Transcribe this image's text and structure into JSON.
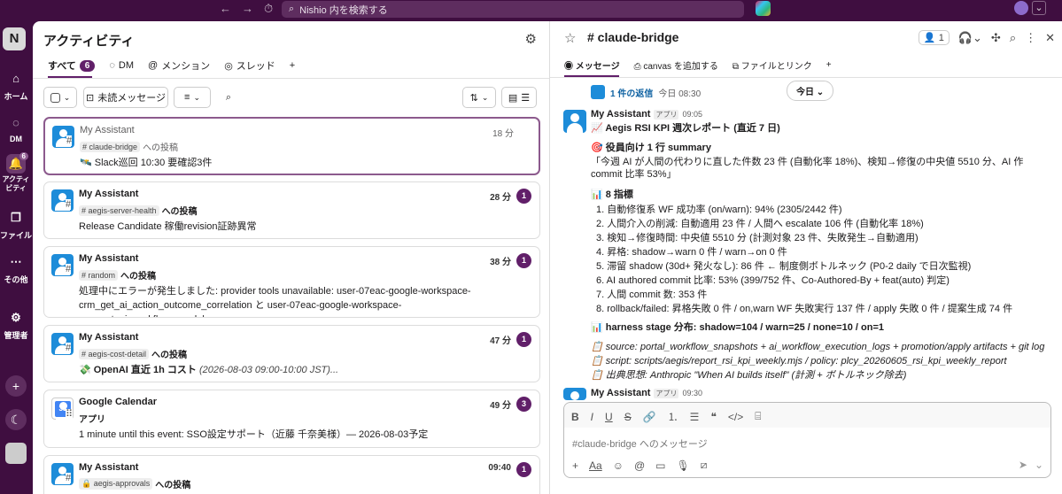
{
  "topbar": {
    "back": "←",
    "forward": "→",
    "history": "⏱",
    "search_placeholder": "Nishio 内を検索する"
  },
  "rail": {
    "workspace_initial": "N",
    "items": [
      {
        "label": "ホーム",
        "icon": "home-icon"
      },
      {
        "label": "DM",
        "icon": "dm-icon"
      },
      {
        "label": "アクティビティ",
        "icon": "bell-icon",
        "badge": "6"
      },
      {
        "label": "ファイル",
        "icon": "files-icon"
      },
      {
        "label": "その他",
        "icon": "more-icon"
      },
      {
        "label": "管理者",
        "icon": "gear-icon"
      }
    ]
  },
  "activity": {
    "title": "アクティビティ",
    "tabs": [
      {
        "label": "すべて",
        "count": "6"
      },
      {
        "label": "DM"
      },
      {
        "label": "メンション"
      },
      {
        "label": "スレッド"
      }
    ],
    "unread_button": "未読メッセージ",
    "items": [
      {
        "title": "My Assistant",
        "channel": "claude-bridge",
        "suffix": "への投稿",
        "body": "🛰️ Slack巡回 10:30 要確認3件",
        "time": "18 分",
        "count": ""
      },
      {
        "title": "My Assistant",
        "channel": "aegis-server-health",
        "suffix": "への投稿",
        "body": "Release Candidate 稼働revision証跡異常",
        "time": "28 分",
        "count": "1"
      },
      {
        "title": "My Assistant",
        "channel": "random",
        "suffix": "への投稿",
        "body": "処理中にエラーが発生しました: provider tools unavailable: user-07eac-google-workspace-crm_get_ai_action_outcome_correlation と user-07eac-google-workspace-crm_get_ai_workflow_send_lo...",
        "time": "38 分",
        "count": "1"
      },
      {
        "title": "My Assistant",
        "channel": "aegis-cost-detail",
        "suffix": "への投稿",
        "body": "💸 OpenAI 直近 1h コスト",
        "body_extra": "(2026-08-03 09:00-10:00 JST)...",
        "time": "47 分",
        "count": "1"
      },
      {
        "title": "Google Calendar",
        "channel": "",
        "suffix": "アプリ",
        "body": "1 minute until this event: SSO設定サポート（近藤 千奈美様）— 2026-08-03予定",
        "time": "49 分",
        "count": "3"
      },
      {
        "title": "My Assistant",
        "channel": "aegis-approvals",
        "suffix": "への投稿",
        "body": "",
        "time": "09:40",
        "count": "1"
      }
    ]
  },
  "channel": {
    "name": "# claude-bridge",
    "members": "1",
    "tabs": [
      "メッセージ",
      "canvas を追加する",
      "ファイルとリンク"
    ],
    "thread_reply": "1 件の返信",
    "thread_time": "今日 08:30",
    "date_divider": "今日",
    "message": {
      "author": "My Assistant",
      "app_tag": "アプリ",
      "time": "09:05",
      "lines": [
        "📈 Aegis RSI KPI 週次レポート (直近 7 日)",
        "🎯 役員向け 1 行 summary",
        "「今週 AI が人間の代わりに直した件数 23 件 (自動化率 18%)、検知→修復の中央値 5510 分、AI 作 commit 比率 53%」",
        "📊 8 指標",
        "1. 自動修復系 WF 成功率 (on/warn): 94% (2305/2442 件)",
        "2. 人間介入の削減: 自動適用 23 件 / 人間へ escalate 106 件 (自動化率 18%)",
        "3. 検知→修復時間: 中央値 5510 分 (計測対象 23 件、失敗発生→自動適用)",
        "4. 昇格: shadow→warn 0 件 / warn→on 0 件",
        "5. 滞留 shadow (30d+ 発火なし): 86 件 ← 制度側ボトルネック (P0-2 daily で日次監視)",
        "6. AI authored commit 比率: 53% (399/752 件、Co-Authored-By + feat(auto) 判定)",
        "7. 人間 commit 数: 353 件",
        "8. rollback/failed: 昇格失敗 0 件 / on,warn WF 失敗実行 137 件 / apply 失敗 0 件 / 提案生成 74 件",
        "📊 harness stage 分布: shadow=104 / warn=25 / none=10 / on=1",
        "📋 source: portal_workflow_snapshots + ai_workflow_execution_logs + promotion/apply artifacts + git log",
        "📋 script: scripts/aegis/report_rsi_kpi_weekly.mjs / policy: plcy_20260605_rsi_kpi_weekly_report",
        "📋 出典思想: Anthropic \"When AI builds itself\" (計測 + ボトルネック除去)"
      ]
    },
    "next_message": {
      "author": "My Assistant",
      "app_tag": "アプリ",
      "time": "09:30"
    },
    "composer_placeholder": "#claude-bridge へのメッセージ"
  }
}
